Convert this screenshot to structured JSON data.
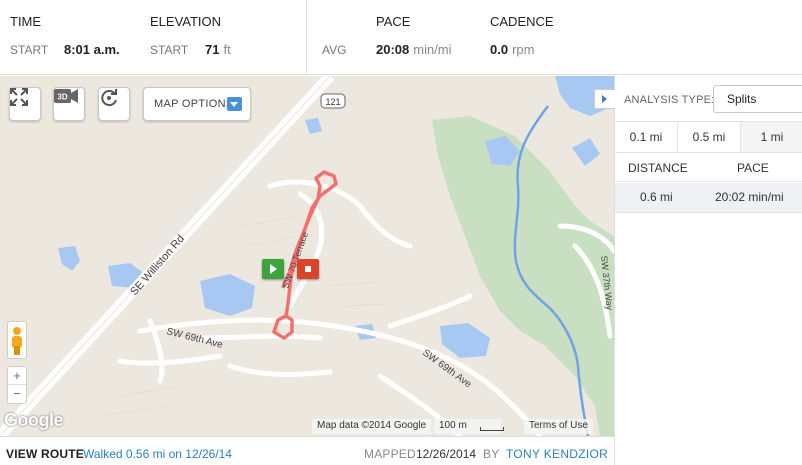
{
  "stats": {
    "time": {
      "header": "TIME",
      "key": "START",
      "value": "8:01 a.m.",
      "unit": ""
    },
    "elevation": {
      "header": "ELEVATION",
      "key": "START",
      "value": "71",
      "unit": "ft"
    },
    "pace": {
      "header": "PACE",
      "key": "AVG",
      "value": "20:08",
      "unit": "min/mi"
    },
    "cadence": {
      "header": "CADENCE",
      "value": "0.0",
      "unit": "rpm"
    }
  },
  "map": {
    "controls": {
      "fullscreen_icon": "fullscreen-icon",
      "view3d_label": "3D",
      "rotate_icon": "rotate-icon",
      "map_options_label": "MAP OPTIONS",
      "zoom_in": "+",
      "zoom_out": "−"
    },
    "labels": {
      "road_sign": "121",
      "williston": "SE Williston Rd",
      "sw69_a": "SW 69th Ave",
      "sw69_b": "SW 69th Ave",
      "terrace": "SW 70 Terrace",
      "sw37": "SW 37th Way"
    },
    "google_logo": "Google",
    "attribution": "Map data ©2014 Google",
    "scale_label": "100 m",
    "terms": "Terms of Use",
    "route_color": "#f2706f",
    "water_color": "#a6c8f2",
    "park_color": "#c9dfc1",
    "start_color": "#3ea33e",
    "stop_color": "#d9452b"
  },
  "panel": {
    "analysis_type_label": "ANALYSIS TYPE:",
    "analysis_type_value": "Splits",
    "tabs": [
      "0.1 mi",
      "0.5 mi",
      "1 mi"
    ],
    "selected_tab": "1 mi",
    "columns": [
      "DISTANCE",
      "PACE"
    ],
    "rows": [
      {
        "distance": "0.6 mi",
        "pace": "20:02 min/mi"
      }
    ]
  },
  "footer": {
    "view_route": "VIEW ROUTE",
    "walked": "Walked 0.56 mi on 12/26/14",
    "mapped_label": "MAPPED",
    "mapped_date": "12/26/2014",
    "by": "BY",
    "author": "TONY KENDZIOR"
  }
}
